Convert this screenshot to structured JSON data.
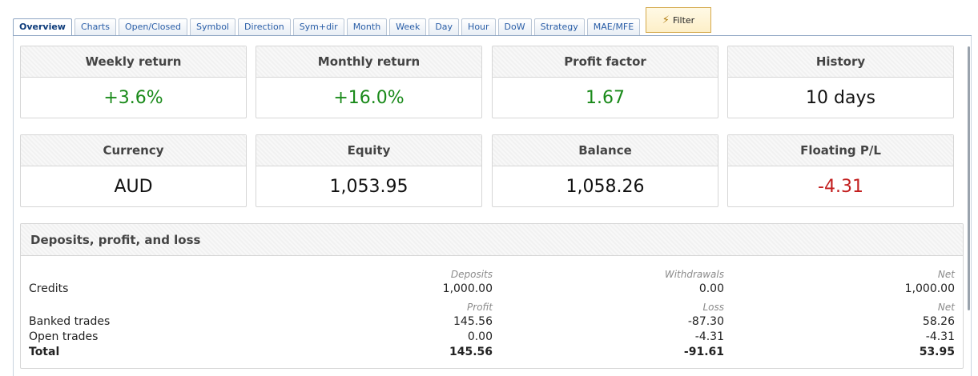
{
  "tabs": [
    "Overview",
    "Charts",
    "Open/Closed",
    "Symbol",
    "Direction",
    "Sym+dir",
    "Month",
    "Week",
    "Day",
    "Hour",
    "DoW",
    "Strategy",
    "MAE/MFE"
  ],
  "filter": {
    "label": "Filter",
    "icon": "filter-icon"
  },
  "cards": [
    {
      "title": "Weekly return",
      "value": "+3.6%"
    },
    {
      "title": "Monthly return",
      "value": "+16.0%"
    },
    {
      "title": "Profit factor",
      "value": "1.67"
    },
    {
      "title": "History",
      "value": "10 days"
    },
    {
      "title": "Currency",
      "value": "AUD"
    },
    {
      "title": "Equity",
      "value": "1,053.95"
    },
    {
      "title": "Balance",
      "value": "1,058.26"
    },
    {
      "title": "Floating P/L",
      "value": "-4.31"
    }
  ],
  "colors": {
    "positive": "#1a8a1a",
    "negative": "#c21d1d",
    "accent": "#2a5ea7"
  },
  "deposits": {
    "title": "Deposits, profit, and loss",
    "credit_headers": [
      "Deposits",
      "Withdrawals",
      "Net"
    ],
    "credits": {
      "label": "Credits",
      "c1": "1,000.00",
      "c2": "0.00",
      "c3": "1,000.00"
    },
    "trade_headers": [
      "Profit",
      "Loss",
      "Net"
    ],
    "banked": {
      "label": "Banked trades",
      "c1": "145.56",
      "c2": "-87.30",
      "c3": "58.26"
    },
    "open": {
      "label": "Open trades",
      "c1": "0.00",
      "c2": "-4.31",
      "c3": "-4.31"
    },
    "total": {
      "label": "Total",
      "c1": "145.56",
      "c2": "-91.61",
      "c3": "53.95"
    }
  }
}
